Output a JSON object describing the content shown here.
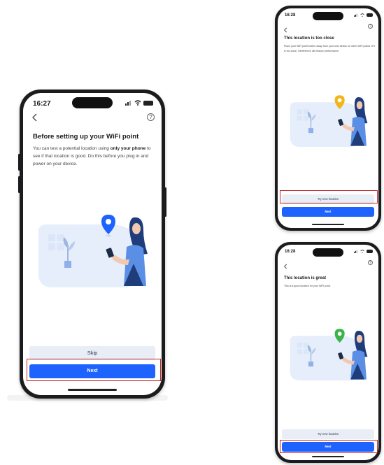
{
  "main_phone": {
    "status_time": "16:27",
    "title": "Before setting up your WiFi point",
    "body_start": "You can test a potential location using ",
    "body_bold": "only your phone",
    "body_end": " to see if that location is good. Do this before you plug in and power on your device.",
    "skip_label": "Skip",
    "next_label": "Next"
  },
  "close_phone": {
    "status_time": "16:28",
    "title": "This location is too close",
    "body": "Place your WiFi point further away from your next device on other WiFi points. If it is too close, interference will reduce performance.",
    "secondary_label": "Try new location",
    "next_label": "Next"
  },
  "great_phone": {
    "status_time": "16:28",
    "title": "This location is great",
    "body": "This is a good location for your WiFi point.",
    "secondary_label": "Try new location",
    "next_label": "Next"
  },
  "icons": {
    "back": "chevron-left-icon",
    "help": "help-circle-icon",
    "location_pin": "location-pin-icon"
  },
  "colors": {
    "primary": "#1f63ff",
    "secondary_bg": "#e8edf6",
    "highlight": "#c0282d",
    "pin_blue": "#1f63ff",
    "pin_yellow": "#f2b61d",
    "pin_green": "#3cb44a",
    "illus_bg": "#e6eefb"
  }
}
